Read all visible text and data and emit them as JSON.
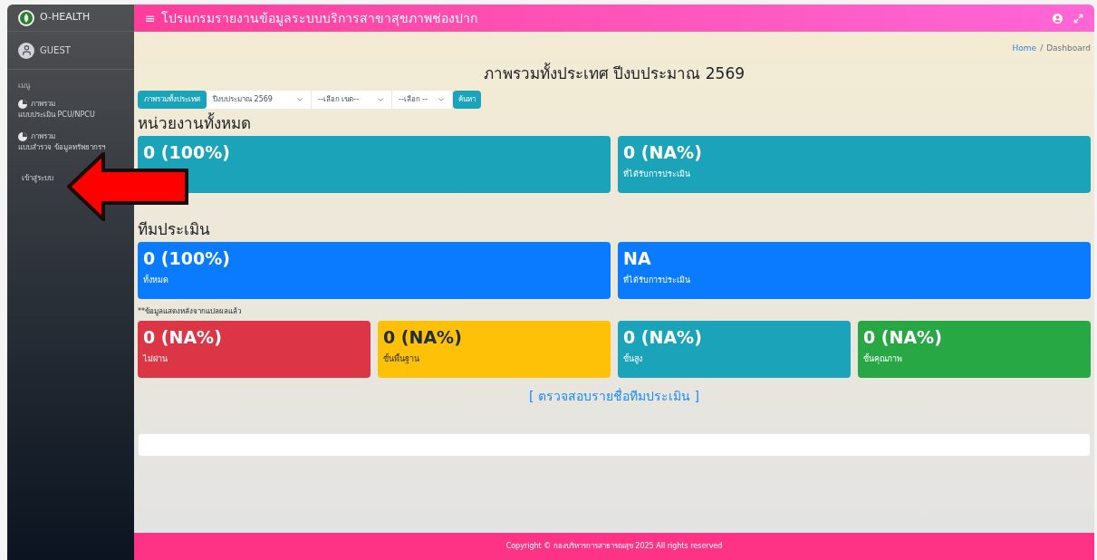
{
  "sidebar": {
    "brand": "O-HEALTH",
    "user": "GUEST",
    "section": "เมนู",
    "items": [
      {
        "line1": "ภาพรวม",
        "line2": "แบบประเมิน PCU/NPCU",
        "kind": "chart"
      },
      {
        "line1": "ภาพรวม",
        "line2": "แบบสำรวจ ข้อมูลทรัพยากรฯ",
        "kind": "chart"
      },
      {
        "line1": "เข้าสู่ระบบ",
        "kind": "plain"
      }
    ]
  },
  "header": {
    "menu_glyph": "≡",
    "title": "โปรแกรมรายงานข้อมูลระบบบริการสาขาสุขภาพช่องปาก"
  },
  "breadcrumb_separator": "/",
  "breadcrumb": [
    {
      "label": "Home",
      "kind": "link"
    },
    {
      "label": "Dashboard",
      "kind": "current"
    }
  ],
  "page_title": "ภาพรวมทั้งประเทศ ปีงบประมาณ 2569",
  "filters": {
    "overview_button": "ภาพรวมทั้งประเทศ",
    "selects": [
      {
        "value": "ปีงบประมาณ 2569"
      },
      {
        "value": "--เลือก เขต--"
      },
      {
        "value": "--เลือก --"
      }
    ],
    "search_button": "ค้นหา"
  },
  "sections": [
    {
      "title": "หน่วยงานทั้งหมด",
      "cards": [
        {
          "value": "0 (100%)",
          "color": "#1ba3b9"
        },
        {
          "value": "0 (NA%)",
          "label": "ที่ได้รับการประเมิน",
          "color": "#1ba3b9"
        }
      ]
    },
    {
      "title": "ทีมประเมิน",
      "cards": [
        {
          "value": "0 (100%)",
          "label": "ทั้งหมด",
          "color": "#0a7bff"
        },
        {
          "value": "NA",
          "label": "ที่ได้รับการประเมิน",
          "color": "#0a7bff"
        }
      ]
    }
  ],
  "note": "**ข้อมูลแสดงหลังจากแปลผลแล้ว",
  "result_cards": [
    {
      "value": "0 (NA%)",
      "label": "ไม่ผ่าน",
      "color": "#dc3545"
    },
    {
      "value": "0 (NA%)",
      "label": "ขั้นพื้นฐาน",
      "color": "#ffc107"
    },
    {
      "value": "0 (NA%)",
      "label": "ขั้นสูง",
      "color": "#1ba3b9"
    },
    {
      "value": "0 (NA%)",
      "label": "ขั้นคุณภาพ",
      "color": "#28a745"
    }
  ],
  "team_link": "[ ตรวจสอบรายชื่อทีมประเมิน ]",
  "footer": "Copyright © กองบริหารการสาธารณสุข 2025 All rights reserved"
}
